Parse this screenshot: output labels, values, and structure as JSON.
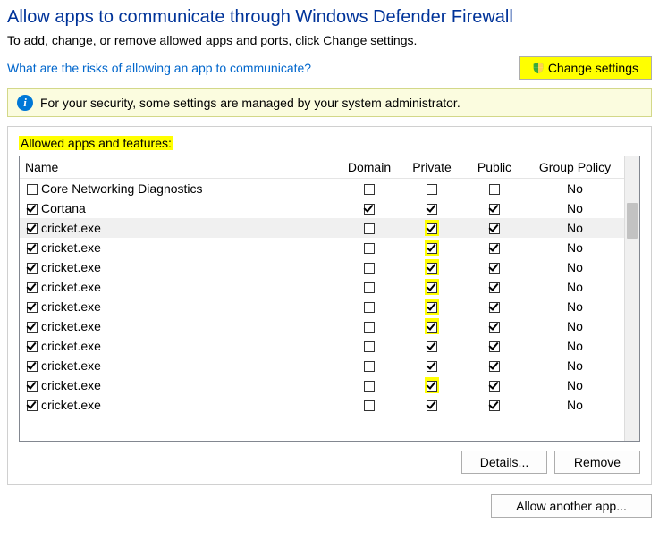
{
  "title": "Allow apps to communicate through Windows Defender Firewall",
  "subtitle": "To add, change, or remove allowed apps and ports, click Change settings.",
  "risk_link": "What are the risks of allowing an app to communicate?",
  "change_settings_label": "Change settings",
  "info_message": "For your security, some settings are managed by your system administrator.",
  "section_label": "Allowed apps and features:",
  "columns": {
    "name": "Name",
    "domain": "Domain",
    "private": "Private",
    "public": "Public",
    "policy": "Group Policy"
  },
  "rows": [
    {
      "name": "Core Networking Diagnostics",
      "name_checked": false,
      "domain": false,
      "private": false,
      "private_hl": false,
      "public": false,
      "policy": "No",
      "selected": false
    },
    {
      "name": "Cortana",
      "name_checked": true,
      "domain": true,
      "private": true,
      "private_hl": false,
      "public": true,
      "policy": "No",
      "selected": false
    },
    {
      "name": "cricket.exe",
      "name_checked": true,
      "domain": false,
      "private": true,
      "private_hl": true,
      "public": true,
      "policy": "No",
      "selected": true
    },
    {
      "name": "cricket.exe",
      "name_checked": true,
      "domain": false,
      "private": true,
      "private_hl": true,
      "public": true,
      "policy": "No",
      "selected": false
    },
    {
      "name": "cricket.exe",
      "name_checked": true,
      "domain": false,
      "private": true,
      "private_hl": true,
      "public": true,
      "policy": "No",
      "selected": false
    },
    {
      "name": "cricket.exe",
      "name_checked": true,
      "domain": false,
      "private": true,
      "private_hl": true,
      "public": true,
      "policy": "No",
      "selected": false
    },
    {
      "name": "cricket.exe",
      "name_checked": true,
      "domain": false,
      "private": true,
      "private_hl": true,
      "public": true,
      "policy": "No",
      "selected": false
    },
    {
      "name": "cricket.exe",
      "name_checked": true,
      "domain": false,
      "private": true,
      "private_hl": true,
      "public": true,
      "policy": "No",
      "selected": false
    },
    {
      "name": "cricket.exe",
      "name_checked": true,
      "domain": false,
      "private": true,
      "private_hl": false,
      "public": true,
      "policy": "No",
      "selected": false
    },
    {
      "name": "cricket.exe",
      "name_checked": true,
      "domain": false,
      "private": true,
      "private_hl": false,
      "public": true,
      "policy": "No",
      "selected": false
    },
    {
      "name": "cricket.exe",
      "name_checked": true,
      "domain": false,
      "private": true,
      "private_hl": true,
      "public": true,
      "policy": "No",
      "selected": false
    },
    {
      "name": "cricket.exe",
      "name_checked": true,
      "domain": false,
      "private": true,
      "private_hl": false,
      "public": true,
      "policy": "No",
      "selected": false
    }
  ],
  "buttons": {
    "details": "Details...",
    "remove": "Remove",
    "allow_another": "Allow another app..."
  }
}
